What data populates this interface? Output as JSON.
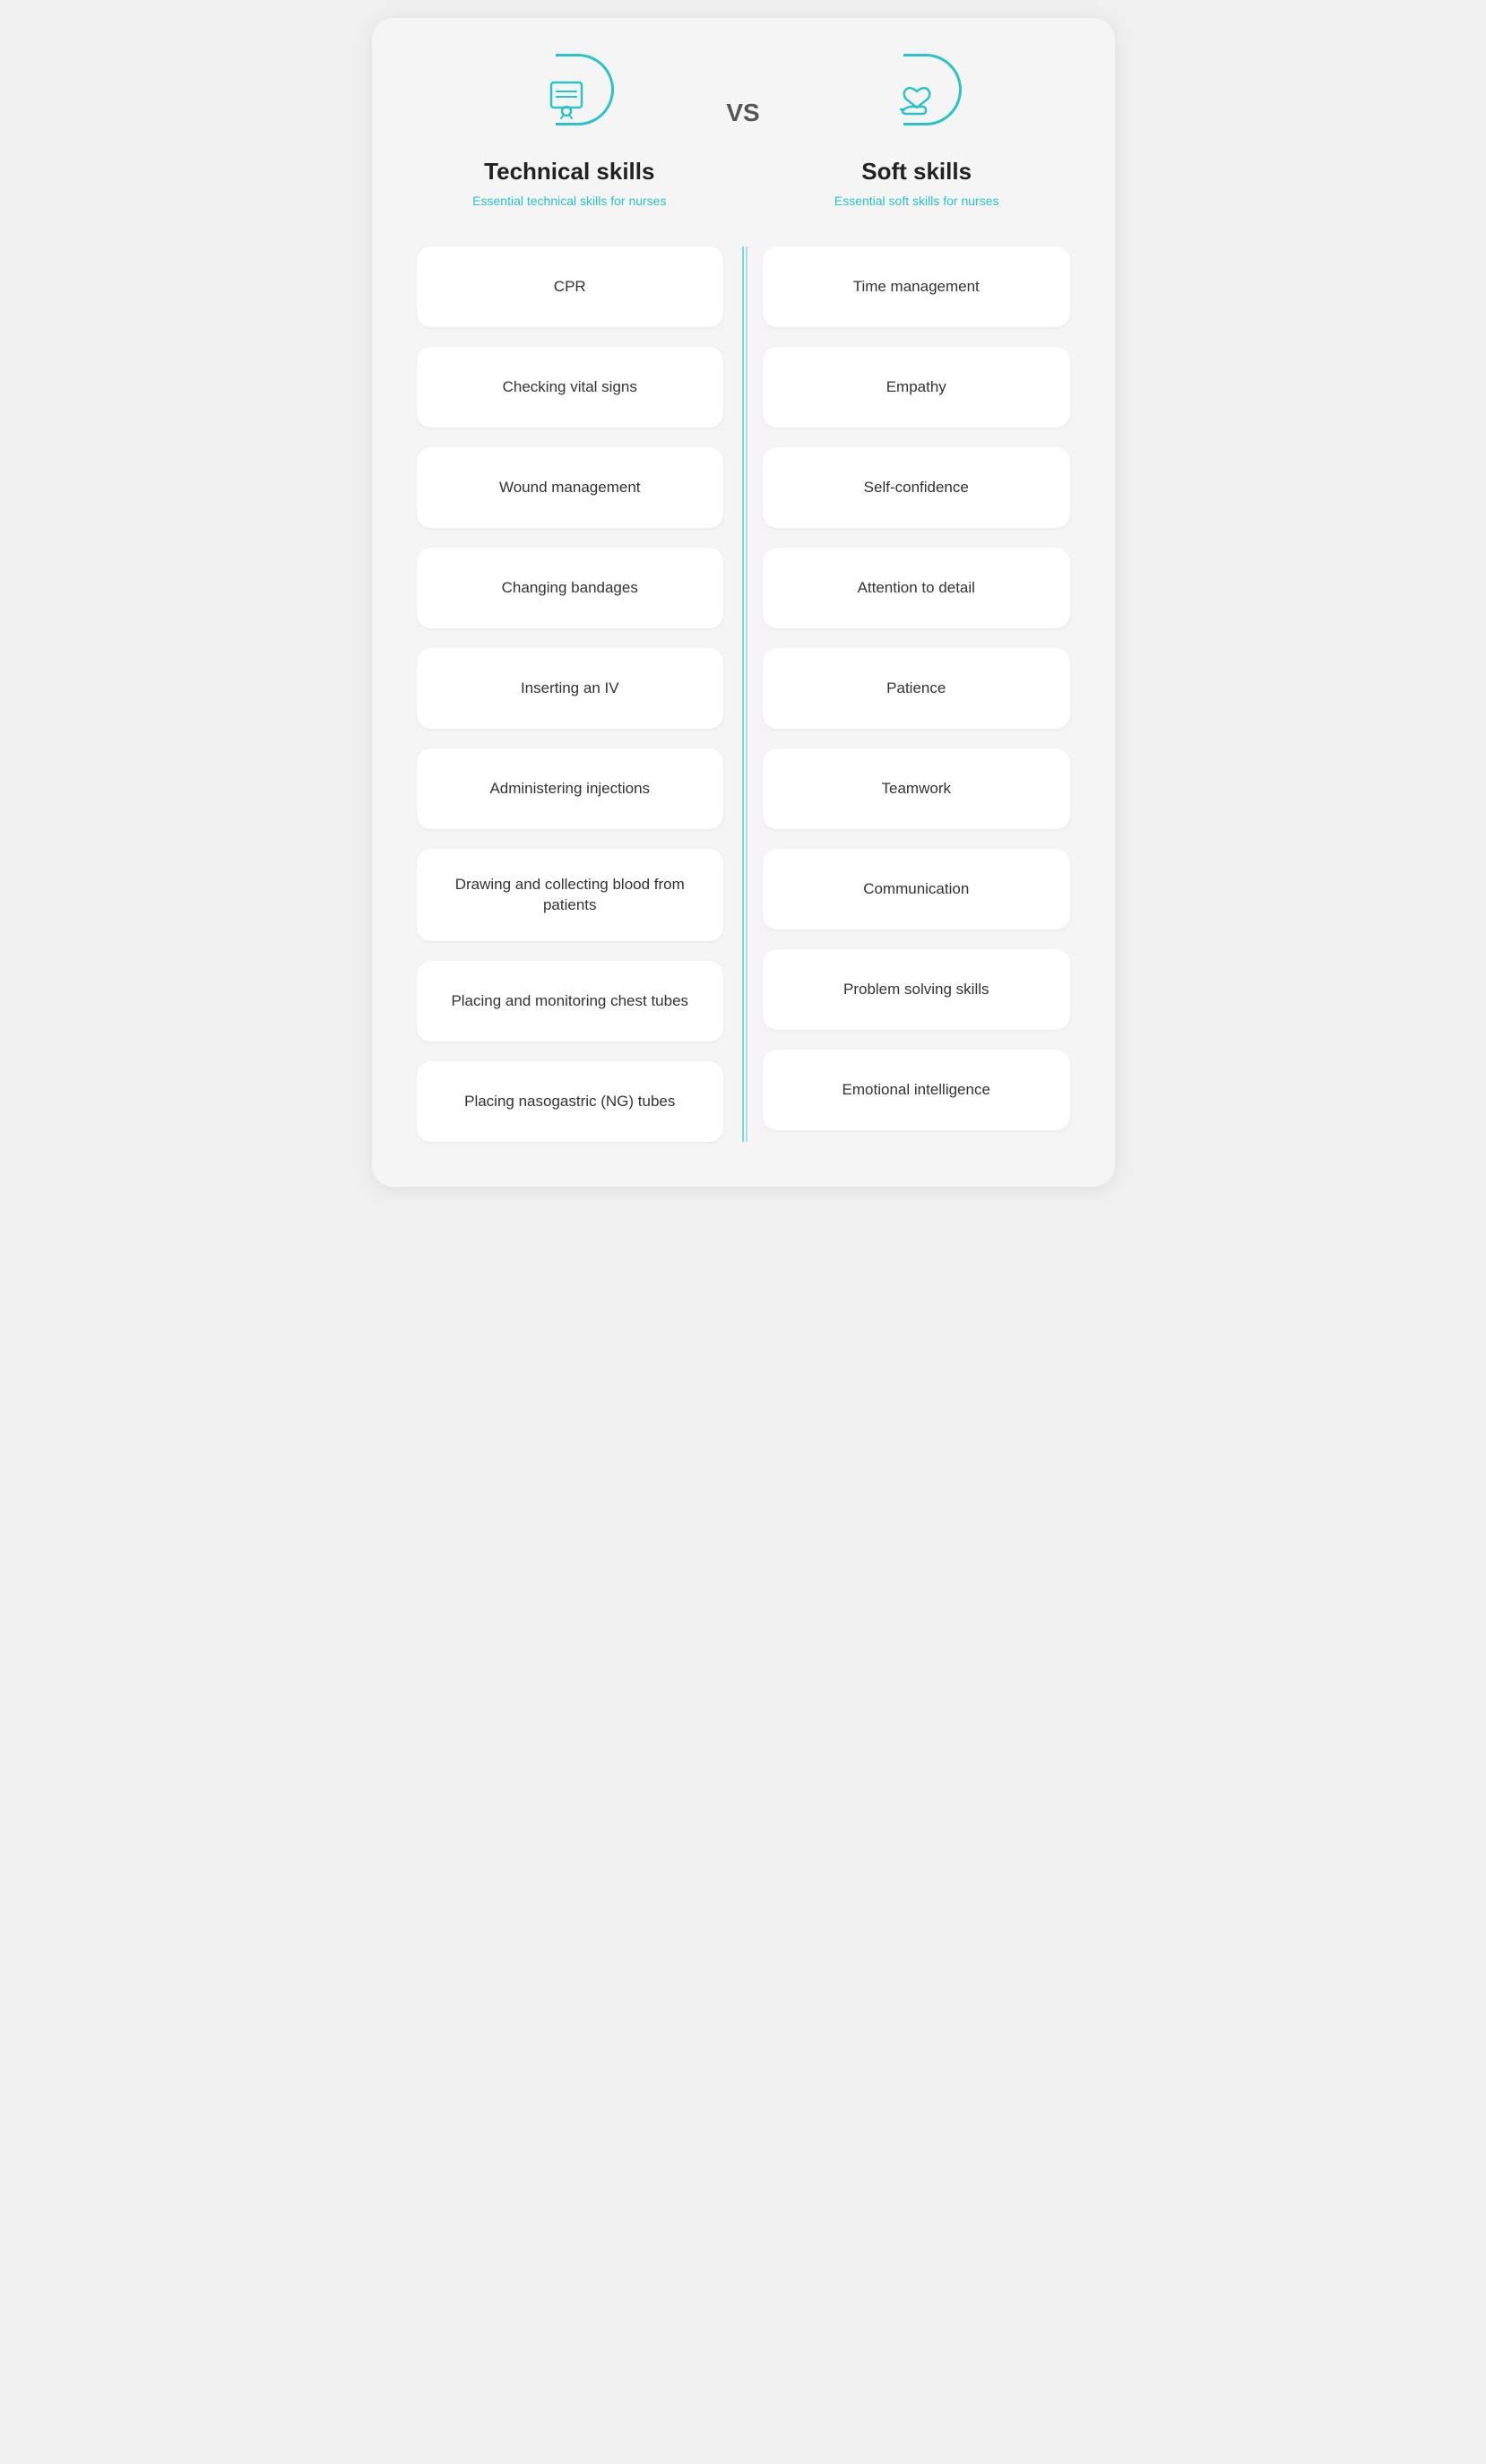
{
  "header": {
    "vs_label": "VS",
    "left": {
      "title": "Technical skills",
      "subtitle": "Essential technical skills for nurses"
    },
    "right": {
      "title": "Soft skills",
      "subtitle": "Essential soft skills for nurses"
    }
  },
  "technical_skills": [
    "CPR",
    "Checking vital signs",
    "Wound management",
    "Changing bandages",
    "Inserting an IV",
    "Administering injections",
    "Drawing and collecting blood from patients",
    "Placing and monitoring chest tubes",
    "Placing nasogastric (NG) tubes"
  ],
  "soft_skills": [
    "Time management",
    "Empathy",
    "Self-confidence",
    "Attention to detail",
    "Patience",
    "Teamwork",
    "Communication",
    "Problem solving skills",
    "Emotional intelligence"
  ]
}
